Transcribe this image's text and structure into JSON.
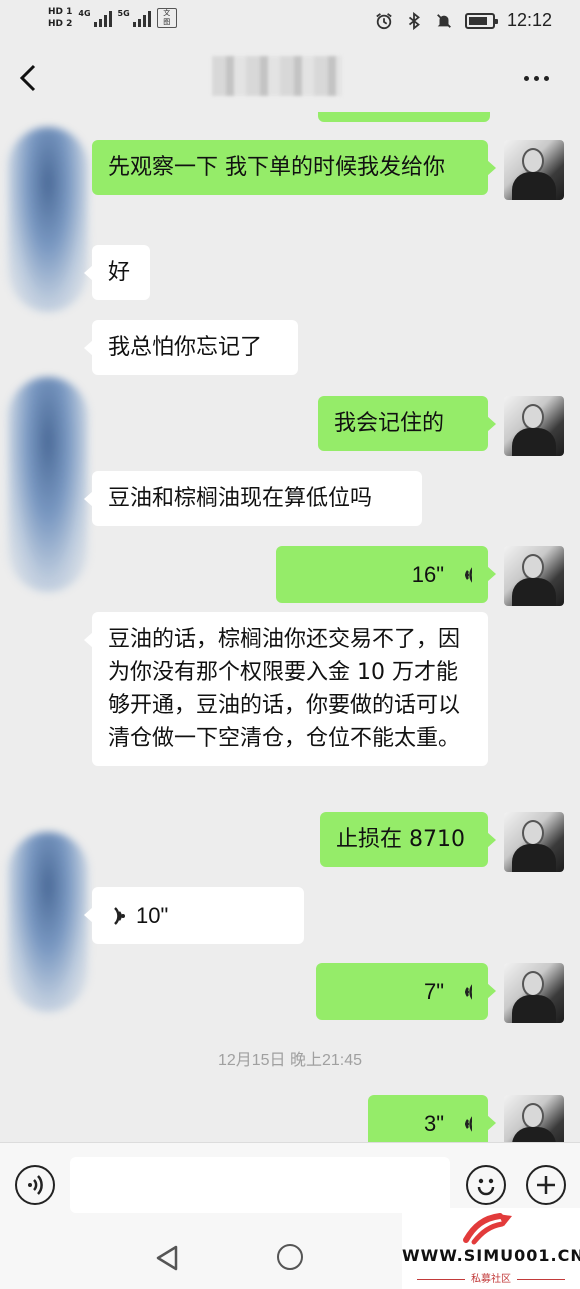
{
  "status_bar": {
    "sim1": "HD 1",
    "sim2": "HD 2",
    "net1": "4G",
    "net2": "5G",
    "time": "12:12"
  },
  "title_bar": {
    "back_icon": "chevron-left-icon",
    "more_icon": "more-horizontal-icon"
  },
  "messages": [
    {
      "side": "out",
      "type": "text",
      "text": "先观察一下 我下单的时候我发给你"
    },
    {
      "side": "in",
      "type": "text",
      "text": "好"
    },
    {
      "side": "in",
      "type": "text",
      "text": "我总怕你忘记了"
    },
    {
      "side": "out",
      "type": "text",
      "text": "我会记住的"
    },
    {
      "side": "in",
      "type": "text",
      "text": "豆油和棕榈油现在算低位吗"
    },
    {
      "side": "out",
      "type": "voice",
      "duration": "16\""
    },
    {
      "side": "in",
      "type": "text",
      "text": "豆油的话，棕榈油你还交易不了，因为你没有那个权限要入金 10 万才能够开通，豆油的话，你要做的话可以清仓做一下空清仓，仓位不能太重。"
    },
    {
      "side": "out",
      "type": "text",
      "text": "止损在 8710"
    },
    {
      "side": "in",
      "type": "voice",
      "duration": "10\""
    },
    {
      "side": "out",
      "type": "voice",
      "duration": "7\""
    },
    {
      "side": "out",
      "type": "voice",
      "duration": "3\""
    }
  ],
  "timestamp": "12月15日 晚上21:45",
  "input_bar": {
    "voice_icon": "voice-mode-icon",
    "emoji_icon": "emoji-icon",
    "plus_icon": "plus-icon",
    "value": ""
  },
  "watermark": {
    "text": "WWW.SIMU001.CN",
    "subtext": "私募社区"
  }
}
